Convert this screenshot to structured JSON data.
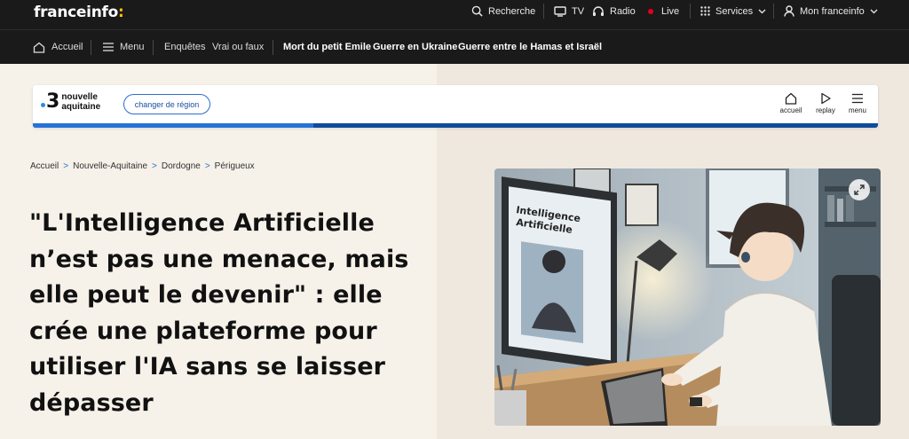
{
  "topbar": {
    "logo_text": "franceinfo",
    "logo_colon": ":",
    "items": [
      {
        "label": "Recherche",
        "icon": "search-icon"
      },
      {
        "label": "TV",
        "icon": "tv-icon"
      },
      {
        "label": "Radio",
        "icon": "headphones-icon"
      },
      {
        "label": "Live",
        "icon": "live-dot-icon"
      },
      {
        "label": "Services",
        "icon": "grid-icon"
      },
      {
        "label": "Mon franceinfo",
        "icon": "user-icon"
      }
    ]
  },
  "navbar": {
    "home_label": "Accueil",
    "menu_label": "Menu",
    "links": [
      "Enquêtes",
      "Vrai ou faux"
    ],
    "hot_topics": [
      "Mort du petit Emile",
      "Guerre en Ukraine",
      "Guerre entre le Hamas et Israël"
    ]
  },
  "region": {
    "logo_number": "3",
    "logo_line1": "nouvelle",
    "logo_line2": "aquitaine",
    "change_button": "changer de région",
    "icons": [
      {
        "label": "accueil",
        "icon": "home-icon"
      },
      {
        "label": "replay",
        "icon": "play-icon"
      },
      {
        "label": "menu",
        "icon": "menu-icon"
      }
    ]
  },
  "breadcrumb": [
    "Accueil",
    "Nouvelle-Aquitaine",
    "Dordogne",
    "Périgueux"
  ],
  "breadcrumb_sep": ">",
  "article": {
    "headline": "\"L'Intelligence Artificielle n’est pas une menace, mais elle peut le devenir\" : elle crée une plateforme pour utiliser l'IA sans se laisser dépasser",
    "image_screen_text_line1": "Intelligence",
    "image_screen_text_line2": "Artificielle"
  },
  "colors": {
    "topbar_bg": "#1a1a1a",
    "accent_yellow": "#fbc300",
    "live_red": "#e3001b",
    "region_blue": "#0f4c9a",
    "page_bg": "#f6f1e9"
  }
}
